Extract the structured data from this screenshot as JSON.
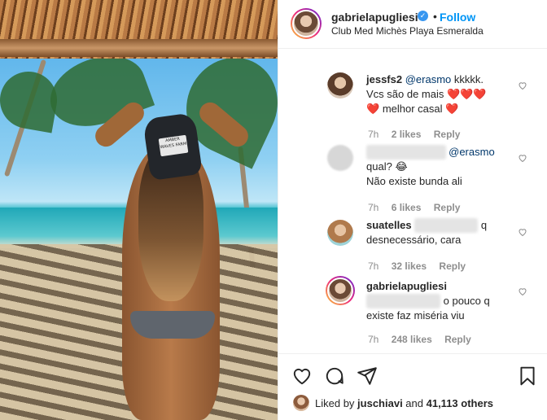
{
  "post": {
    "username": "gabrielapugliesi",
    "location": "Club Med Michès Playa Esmeralda",
    "follow_label": "Follow",
    "dot": "•",
    "verified_mark": "✓",
    "photo_cap_text": "AMBER WAVES FARM"
  },
  "comments": [
    {
      "username": "jessfs2",
      "mention": "@erasmo",
      "text_after_mention": " kkkkk.",
      "line2": "Vcs são de mais",
      "line3": "melhor casal",
      "time": "7h",
      "likes": "2 likes",
      "reply": "Reply"
    },
    {
      "username": "",
      "mention": "@erasmo",
      "line2": "qual?",
      "emoji": "😂",
      "line3": "Não existe bunda ali",
      "time": "7h",
      "likes": "6 likes",
      "reply": "Reply"
    },
    {
      "username": "suatelles",
      "trailing": "q",
      "line2": "desnecessário, cara",
      "time": "7h",
      "likes": "32 likes",
      "reply": "Reply"
    },
    {
      "username": "gabrielapugliesi",
      "text_after_blur": "o pouco q",
      "line2": "existe faz miséria viu",
      "time": "7h",
      "likes": "248 likes",
      "reply": "Reply"
    }
  ],
  "footer": {
    "liked_by_prefix": "Liked by ",
    "liked_by_user": "juschiavi",
    "and": " and ",
    "others_count": "41,113 others"
  },
  "icons": {
    "like": "heart-icon",
    "comment": "comment-icon",
    "share": "share-icon",
    "save": "bookmark-icon"
  },
  "colors": {
    "follow": "#0095f6",
    "heart": "#ed4956",
    "meta": "#8e8e8e"
  }
}
